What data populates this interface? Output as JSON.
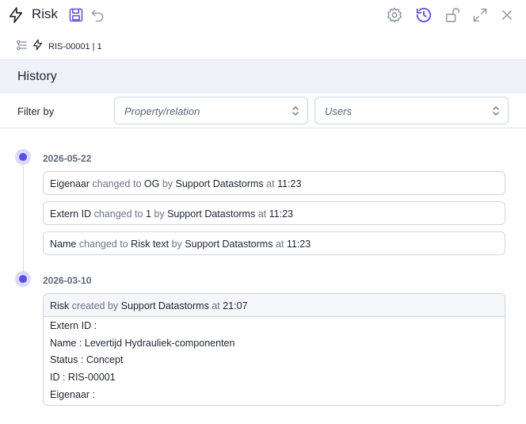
{
  "header": {
    "title": "Risk",
    "icons": [
      "lightning-icon",
      "save-icon",
      "undo-icon",
      "settings-icon",
      "history-icon",
      "unlock-icon",
      "expand-icon",
      "close-icon"
    ],
    "accent_color": "#5b4ee8"
  },
  "breadcrumb": {
    "text": "RIS-00001 | 1"
  },
  "history": {
    "title": "History"
  },
  "filter": {
    "label": "Filter by",
    "property": {
      "placeholder": "Property/relation"
    },
    "users": {
      "placeholder": "Users"
    }
  },
  "groups": [
    {
      "date": "2026-05-22",
      "entries": [
        {
          "subject": "Eigenaar",
          "action": "changed to",
          "value": "OG",
          "by": "by",
          "user": "Support Datastorms",
          "at": "at",
          "time": "11:23"
        },
        {
          "subject": "Extern ID",
          "action": "changed to",
          "value": "1",
          "by": "by",
          "user": "Support Datastorms",
          "at": "at",
          "time": "11:23"
        },
        {
          "subject": "Name",
          "action": "changed to",
          "value": "Risk text",
          "by": "by",
          "user": "Support Datastorms",
          "at": "at",
          "time": "11:23"
        }
      ]
    },
    {
      "date": "2026-03-10",
      "created": {
        "subject": "Risk",
        "action": "created by",
        "user": "Support Datastorms",
        "at": "at",
        "time": "21:07",
        "fields": [
          "Extern ID :",
          "Name : Levertijd Hydrauliek-componenten",
          "Status : Concept",
          "ID : RIS-00001",
          "Eigenaar :"
        ]
      }
    }
  ]
}
